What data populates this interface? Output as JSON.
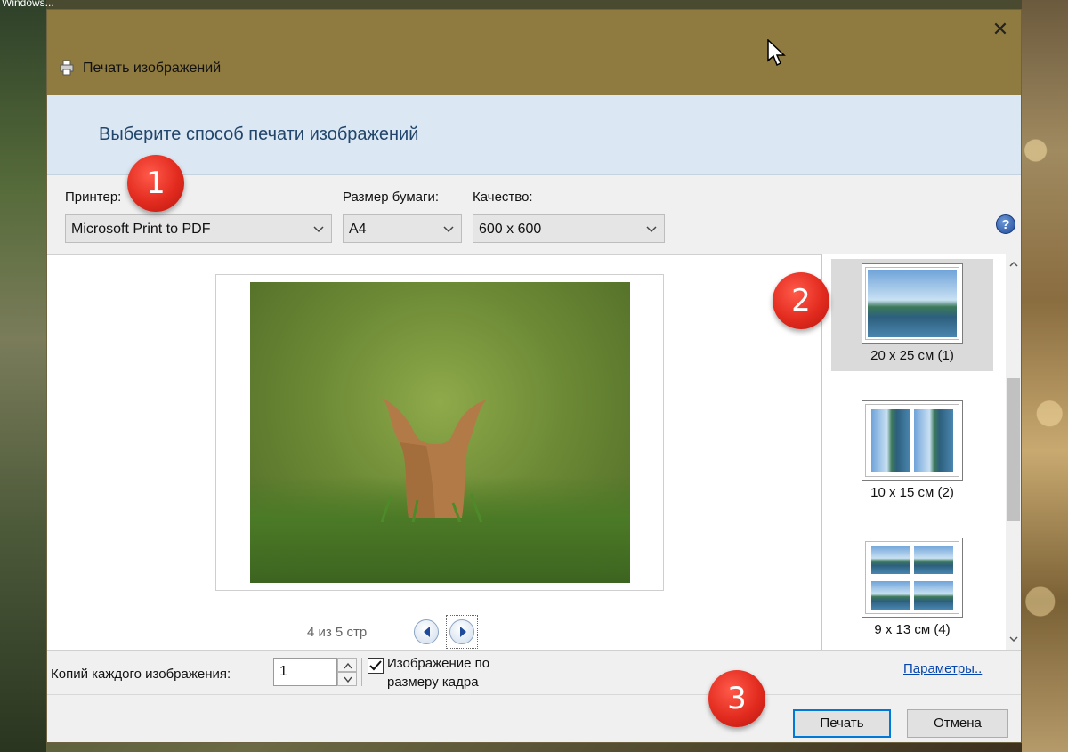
{
  "desktop": {
    "label": "Windows..."
  },
  "dialog": {
    "title": "Печать изображений",
    "close_glyph": "✕",
    "header": "Выберите способ печати изображений",
    "colors": {
      "titlebar": "#8f7b3f",
      "header_band": "#dbe7f2",
      "accent": "#0078d7"
    }
  },
  "options": {
    "printer": {
      "label": "Принтер:",
      "value": "Microsoft Print to PDF"
    },
    "paper": {
      "label": "Размер бумаги:",
      "value": "A4"
    },
    "quality": {
      "label": "Качество:",
      "value": "600 x 600"
    },
    "help_glyph": "?"
  },
  "preview": {
    "page_counter": "4 из 5 стр"
  },
  "layouts": [
    {
      "caption": "20 x 25 см (1)",
      "selected": true
    },
    {
      "caption": "10 x 15 см (2)",
      "selected": false
    },
    {
      "caption": "9 x 13 см (4)",
      "selected": false
    }
  ],
  "copies": {
    "label": "Копий каждого изображения:",
    "value": "1",
    "fit_label": "Изображение по размеру кадра",
    "fit_checked": true,
    "params_link": "Параметры.."
  },
  "buttons": {
    "print": "Печать",
    "cancel": "Отмена"
  },
  "badges": [
    "1",
    "2",
    "3"
  ]
}
